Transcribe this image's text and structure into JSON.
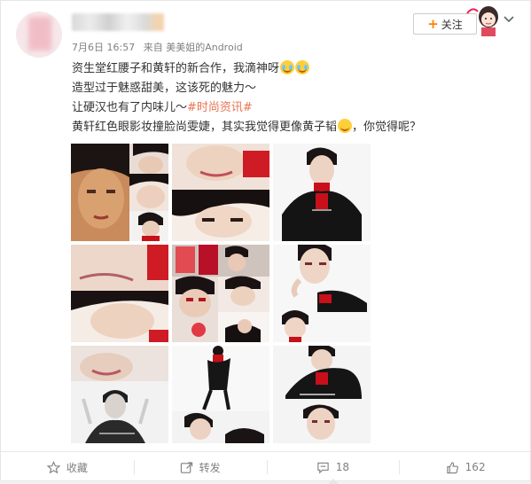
{
  "post": {
    "meta_time": "7月6日 16:57",
    "meta_from": "来自",
    "meta_source": "美美姐的Android",
    "follow_label": "关注",
    "lines": [
      "资生堂红腰子和黄轩的新合作，我滴神呀",
      "造型过于魅惑甜美，这该死的魅力～",
      "让硬汉也有了内味儿～",
      "黄轩红色眼影妆撞脸尚雯婕，其实我觉得更像黄子韬",
      "，你觉得呢？"
    ],
    "hashtag": "#时尚资讯#",
    "icons": {
      "emoji": "laugh-cry-emoji",
      "follow": "plus-icon",
      "menu": "chevron-down-icon"
    }
  },
  "footer": {
    "favorite_label": "收藏",
    "repost_label": "转发",
    "comment_count": "18",
    "like_count": "162"
  },
  "colors": {
    "accent": "#ff8200",
    "hashtag": "#eb7350",
    "muted_text": "#808080",
    "red_outfit": "#d0111b"
  }
}
